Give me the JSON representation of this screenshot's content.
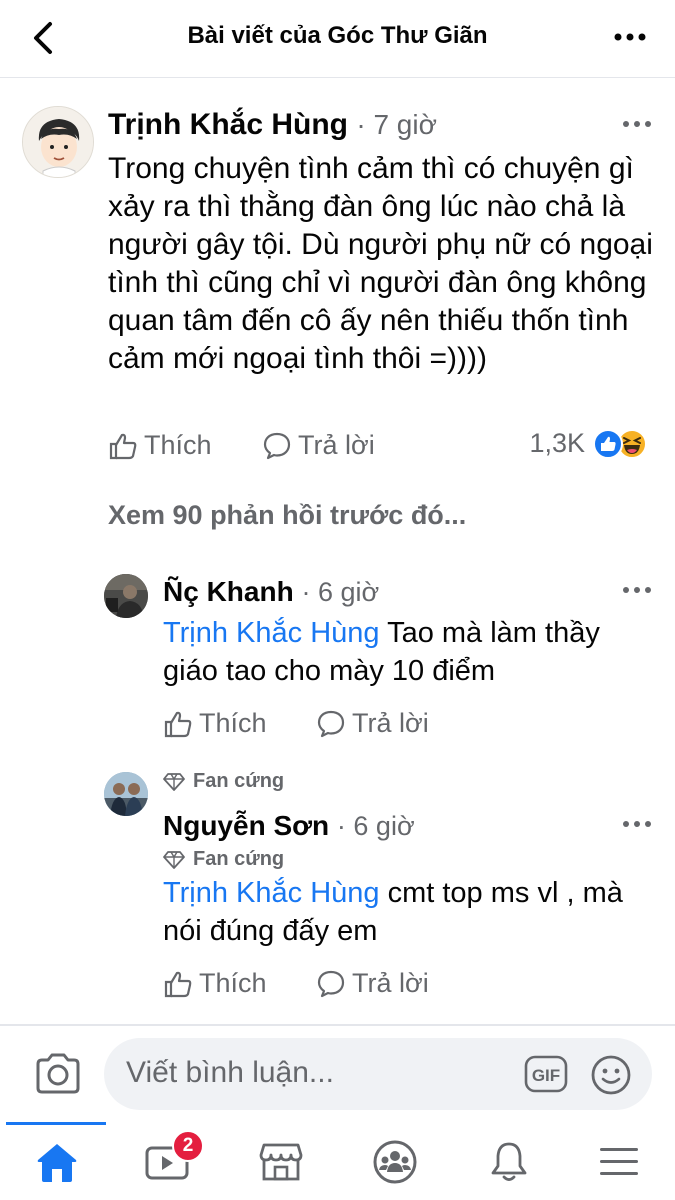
{
  "header": {
    "title": "Bài viết của Góc Thư Giãn"
  },
  "main_comment": {
    "author": "Trịnh Khắc Hùng",
    "time": "· 7 giờ",
    "text": "Trong chuyện tình cảm thì có chuyện gì xảy ra thì thằng đàn ông lúc nào chả là người gây tội. Dù người phụ nữ có ngoại tình thì cũng chỉ vì người đàn ông không quan tâm đến cô ấy nên thiếu thốn tình cảm mới ngoại tình thôi =))))",
    "like_label": "Thích",
    "reply_label": "Trả lời",
    "reaction_count": "1,3K"
  },
  "previous_replies": "Xem 90 phản hồi trước đó...",
  "replies": [
    {
      "author": "Ñç Khanh",
      "time": "· 6 giờ",
      "mention": "Trịnh Khắc Hùng",
      "text": " Tao mà làm thầy giáo tao cho mày 10 điểm",
      "like_label": "Thích",
      "reply_label": "Trả lời"
    },
    {
      "badge": "Fan cứng",
      "author": "Nguyễn Sơn",
      "time": "· 6 giờ",
      "badge2": "Fan cứng",
      "mention": "Trịnh Khắc Hùng",
      "text": " cmt top ms vl , mà nói đúng đấy em",
      "like_label": "Thích",
      "reply_label": "Trả lời"
    }
  ],
  "composer": {
    "placeholder": "Viết bình luận...",
    "gif_label": "GIF"
  },
  "tabbar": {
    "video_badge": "2",
    "tabs": [
      "home-icon",
      "video-icon",
      "marketplace-icon",
      "groups-icon",
      "notifications-icon",
      "menu-icon"
    ]
  },
  "colors": {
    "accent": "#1877f2",
    "secondary_text": "#65676b",
    "badge_red": "#e41e3f",
    "haha_yellow": "#f7b125"
  }
}
